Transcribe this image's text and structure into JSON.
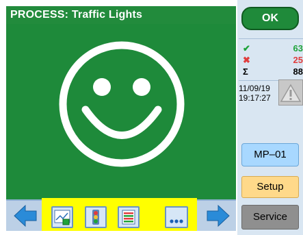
{
  "window": {
    "title": "PROCESS: Traffic Lights"
  },
  "main": {
    "status_icon": "smiley-face-icon",
    "background_color": "#1e8a3a"
  },
  "navbar": {
    "left_arrow_icon": "arrow-left-icon",
    "right_arrow_icon": "arrow-right-icon",
    "highlight_color": "#ffff00",
    "tools": [
      {
        "icon": "image-chart-icon"
      },
      {
        "icon": "traffic-light-icon"
      },
      {
        "icon": "list-bars-icon"
      },
      {
        "icon": "more-dots-icon"
      }
    ]
  },
  "side": {
    "ok_label": "OK",
    "stats": [
      {
        "symbol": "✔",
        "value": "63",
        "color": "#1fa33a"
      },
      {
        "symbol": "✖",
        "value": "25",
        "color": "#e03c3c"
      },
      {
        "symbol": "Σ",
        "value": "88",
        "color": "#000000"
      }
    ],
    "date": "11/09/19",
    "time": "19:17:27",
    "warning_icon": "warning-triangle-icon",
    "mp_label": "MP–01",
    "setup_label": "Setup",
    "service_label": "Service"
  }
}
